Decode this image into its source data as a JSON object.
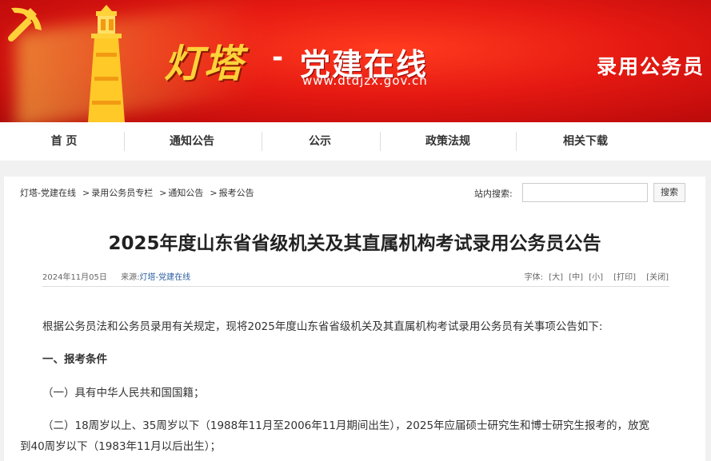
{
  "banner": {
    "brand_script": "灯塔",
    "brand_dash": "-",
    "brand_name": "党建在线",
    "url": "www.dtdjzx.gov.cn",
    "section_title": "录用公务员",
    "colors": {
      "red": "#e51912",
      "gold": "#ffd23a"
    }
  },
  "nav": {
    "items": [
      {
        "label": "首 页"
      },
      {
        "label": "通知公告"
      },
      {
        "label": "公示"
      },
      {
        "label": "政策法规"
      },
      {
        "label": "相关下载"
      }
    ]
  },
  "breadcrumb": {
    "items": [
      "灯塔-党建在线",
      "录用公务员专栏",
      "通知公告",
      "报考公告"
    ],
    "separator": ">"
  },
  "search": {
    "label": "站内搜索:",
    "value": "",
    "placeholder": "",
    "button_label": "搜索"
  },
  "article": {
    "title": "2025年度山东省省级机关及其直属机构考试录用公务员公告",
    "date": "2024年11月05日",
    "source_label": "来源:",
    "source_value": "灯塔-党建在线",
    "font_label": "字体:",
    "font_large": "[大]",
    "font_medium": "[中]",
    "font_small": "[小]",
    "print": "[打印]",
    "close": "[关闭]",
    "paragraphs": {
      "intro": "根据公务员法和公务员录用有关规定，现将2025年度山东省省级机关及其直属机构考试录用公务员有关事项公告如下:",
      "section1": "一、报考条件",
      "item1": "（一）具有中华人民共和国国籍；",
      "item2_line1": "（二）18周岁以上、35周岁以下（1988年11月至2006年11月期间出生），2025年应届硕士研究生和博士研究生报考的，放宽",
      "item2_line2": "到40周岁以下（1983年11月以后出生）；"
    }
  }
}
